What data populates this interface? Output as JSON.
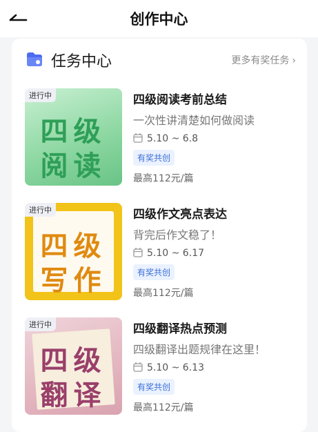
{
  "header": {
    "title": "创作中心"
  },
  "section": {
    "title": "任务中心",
    "more_link": "更多有奖任务",
    "more_chevron": "›"
  },
  "tasks": [
    {
      "status": "进行中",
      "thumb_line1": "四级",
      "thumb_line2": "阅读",
      "title": "四级阅读考前总结",
      "subtitle": "一次性讲清楚如何做阅读",
      "date_range": "5.10 ~ 6.8",
      "badge": "有奖共创",
      "reward": "最高112元/篇"
    },
    {
      "status": "进行中",
      "thumb_line1": "四级",
      "thumb_line2": "写作",
      "title": "四级作文亮点表达",
      "subtitle": "背完后作文稳了！",
      "date_range": "5.10 ~ 6.17",
      "badge": "有奖共创",
      "reward": "最高112元/篇"
    },
    {
      "status": "进行中",
      "thumb_line1": "四级",
      "thumb_line2": "翻译",
      "title": "四级翻译热点预测",
      "subtitle": "四级翻译出题规律在这里！",
      "date_range": "5.10 ~ 6.13",
      "badge": "有奖共创",
      "reward": "最高112元/篇"
    }
  ],
  "colors": {
    "accent_blue": "#3a6fd8",
    "thumb_green": "#8fd8a4",
    "thumb_yellow": "#f2c318",
    "thumb_pink": "#e3b6c0"
  },
  "icons": {
    "back": "back-arrow-icon",
    "folder": "folder-star-icon",
    "calendar": "calendar-icon"
  }
}
